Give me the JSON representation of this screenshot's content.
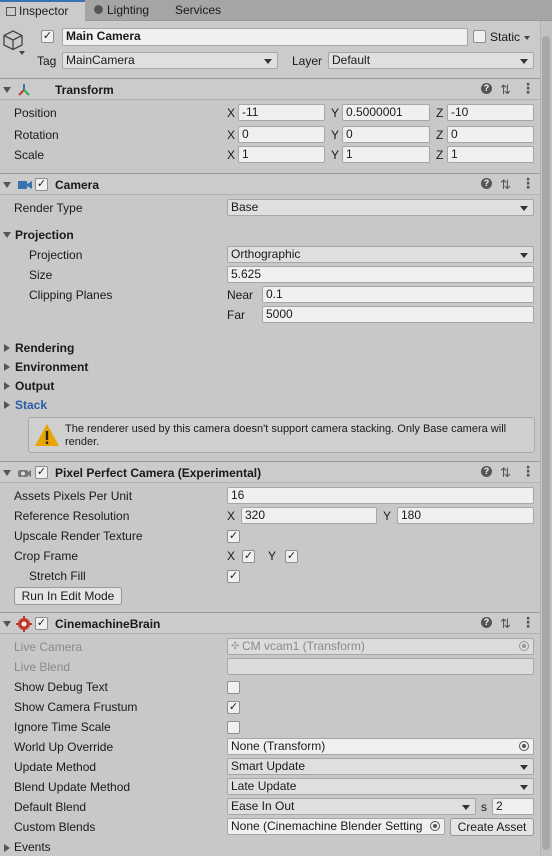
{
  "tabs": [
    {
      "label": "Inspector"
    },
    {
      "label": "Lighting"
    },
    {
      "label": "Services"
    }
  ],
  "object": {
    "name": "Main Camera",
    "static_label": "Static",
    "tag_label": "Tag",
    "tag_value": "MainCamera",
    "layer_label": "Layer",
    "layer_value": "Default"
  },
  "transform": {
    "title": "Transform",
    "position_label": "Position",
    "rotation_label": "Rotation",
    "scale_label": "Scale",
    "axis_x": "X",
    "axis_y": "Y",
    "axis_z": "Z",
    "position": {
      "x": "-11",
      "y": "0.5000001",
      "z": "-10"
    },
    "rotation": {
      "x": "0",
      "y": "0",
      "z": "0"
    },
    "scale": {
      "x": "1",
      "y": "1",
      "z": "1"
    }
  },
  "camera": {
    "title": "Camera",
    "render_type_label": "Render Type",
    "render_type_value": "Base",
    "projection_section": "Projection",
    "projection_label": "Projection",
    "projection_value": "Orthographic",
    "size_label": "Size",
    "size_value": "5.625",
    "clipping_label": "Clipping Planes",
    "near_label": "Near",
    "near_value": "0.1",
    "far_label": "Far",
    "far_value": "5000",
    "rendering": "Rendering",
    "environment": "Environment",
    "output": "Output",
    "stack": "Stack",
    "warning": "The renderer used by this camera doesn't support camera stacking. Only Base camera will render."
  },
  "pixel_perfect": {
    "title": "Pixel Perfect Camera (Experimental)",
    "assets_ppu_label": "Assets Pixels Per Unit",
    "assets_ppu_value": "16",
    "ref_res_label": "Reference Resolution",
    "ref_x_label": "X",
    "ref_x_value": "320",
    "ref_y_label": "Y",
    "ref_y_value": "180",
    "upscale_label": "Upscale Render Texture",
    "crop_label": "Crop Frame",
    "crop_x_label": "X",
    "crop_y_label": "Y",
    "stretch_label": "Stretch Fill",
    "run_button": "Run In Edit Mode"
  },
  "brain": {
    "title": "CinemachineBrain",
    "live_camera_label": "Live Camera",
    "live_camera_value": "CM vcam1 (Transform)",
    "live_blend_label": "Live Blend",
    "debug_text_label": "Show Debug Text",
    "frustum_label": "Show Camera Frustum",
    "ignore_time_label": "Ignore Time Scale",
    "world_up_label": "World Up Override",
    "world_up_value": "None (Transform)",
    "update_method_label": "Update Method",
    "update_method_value": "Smart Update",
    "blend_update_label": "Blend Update Method",
    "blend_update_value": "Late Update",
    "default_blend_label": "Default Blend",
    "default_blend_value": "Ease In Out",
    "blend_s_label": "s",
    "blend_s_value": "2",
    "custom_blends_label": "Custom Blends",
    "custom_blends_value": "None (Cinemachine Blender Setting",
    "create_asset_button": "Create Asset",
    "events_label": "Events"
  },
  "check_glyph": "✓",
  "colors": {
    "accent": "#3a72b0",
    "stack_label": "#2a5ea8",
    "warning": "#e8a400"
  }
}
